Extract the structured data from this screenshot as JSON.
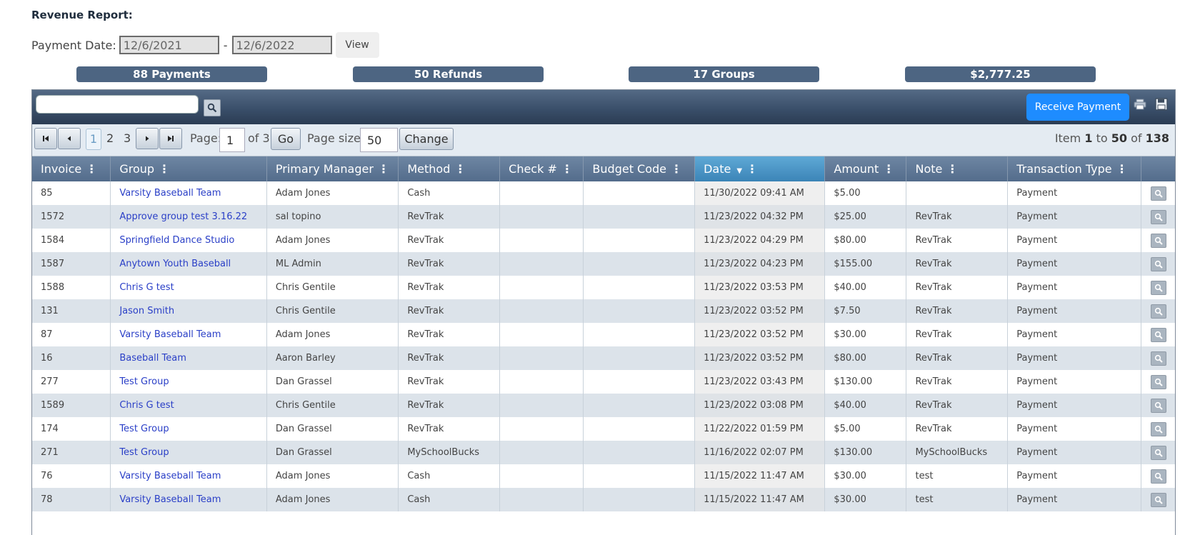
{
  "report": {
    "title": "Revenue Report:",
    "date_label": "Payment Date:",
    "date_from": "12/6/2021",
    "date_sep": "-",
    "date_to": "12/6/2022",
    "view_label": "View"
  },
  "summary": {
    "payments": "88 Payments",
    "refunds": "50 Refunds",
    "groups": "17 Groups",
    "total": "$2,777.25"
  },
  "toolbar": {
    "search_value": "",
    "receive_label": "Receive Payment"
  },
  "pager": {
    "pages": [
      "1",
      "2",
      "3"
    ],
    "current_page": "1",
    "page_label": "Page:",
    "page_value": "1",
    "of_label": "of 3",
    "go_label": "Go",
    "size_label": "Page size:",
    "size_value": "50",
    "change_label": "Change",
    "info_prefix": "Item",
    "info_from": "1",
    "info_to_label": "to",
    "info_to": "50",
    "info_of_label": "of",
    "info_total": "138"
  },
  "columns": [
    "Invoice",
    "Group",
    "Primary Manager",
    "Method",
    "Check #",
    "Budget Code",
    "Date",
    "Amount",
    "Note",
    "Transaction Type"
  ],
  "sorted_column": "Date",
  "rows": [
    {
      "invoice": "85",
      "group": "Varsity Baseball Team",
      "manager": "Adam Jones",
      "method": "Cash",
      "check": "",
      "budget": "",
      "date": "11/30/2022 09:41 AM",
      "amount": "$5.00",
      "note": "",
      "type": "Payment"
    },
    {
      "invoice": "1572",
      "group": "Approve group test 3.16.22",
      "manager": "sal topino",
      "method": "RevTrak",
      "check": "",
      "budget": "",
      "date": "11/23/2022 04:32 PM",
      "amount": "$25.00",
      "note": "RevTrak",
      "type": "Payment"
    },
    {
      "invoice": "1584",
      "group": "Springfield Dance Studio",
      "manager": "Adam Jones",
      "method": "RevTrak",
      "check": "",
      "budget": "",
      "date": "11/23/2022 04:29 PM",
      "amount": "$80.00",
      "note": "RevTrak",
      "type": "Payment"
    },
    {
      "invoice": "1587",
      "group": "Anytown Youth Baseball",
      "manager": "ML Admin",
      "method": "RevTrak",
      "check": "",
      "budget": "",
      "date": "11/23/2022 04:23 PM",
      "amount": "$155.00",
      "note": "RevTrak",
      "type": "Payment"
    },
    {
      "invoice": "1588",
      "group": "Chris G test",
      "manager": "Chris Gentile",
      "method": "RevTrak",
      "check": "",
      "budget": "",
      "date": "11/23/2022 03:53 PM",
      "amount": "$40.00",
      "note": "RevTrak",
      "type": "Payment"
    },
    {
      "invoice": "131",
      "group": "Jason Smith",
      "manager": "Chris Gentile",
      "method": "RevTrak",
      "check": "",
      "budget": "",
      "date": "11/23/2022 03:52 PM",
      "amount": "$7.50",
      "note": "RevTrak",
      "type": "Payment"
    },
    {
      "invoice": "87",
      "group": "Varsity Baseball Team",
      "manager": "Adam Jones",
      "method": "RevTrak",
      "check": "",
      "budget": "",
      "date": "11/23/2022 03:52 PM",
      "amount": "$30.00",
      "note": "RevTrak",
      "type": "Payment"
    },
    {
      "invoice": "16",
      "group": "Baseball Team",
      "manager": "Aaron Barley",
      "method": "RevTrak",
      "check": "",
      "budget": "",
      "date": "11/23/2022 03:52 PM",
      "amount": "$80.00",
      "note": "RevTrak",
      "type": "Payment"
    },
    {
      "invoice": "277",
      "group": "Test Group",
      "manager": "Dan Grassel",
      "method": "RevTrak",
      "check": "",
      "budget": "",
      "date": "11/23/2022 03:43 PM",
      "amount": "$130.00",
      "note": "RevTrak",
      "type": "Payment"
    },
    {
      "invoice": "1589",
      "group": "Chris G test",
      "manager": "Chris Gentile",
      "method": "RevTrak",
      "check": "",
      "budget": "",
      "date": "11/23/2022 03:08 PM",
      "amount": "$40.00",
      "note": "RevTrak",
      "type": "Payment"
    },
    {
      "invoice": "174",
      "group": "Test Group",
      "manager": "Dan Grassel",
      "method": "RevTrak",
      "check": "",
      "budget": "",
      "date": "11/22/2022 01:59 PM",
      "amount": "$5.00",
      "note": "RevTrak",
      "type": "Payment"
    },
    {
      "invoice": "271",
      "group": "Test Group",
      "manager": "Dan Grassel",
      "method": "MySchoolBucks",
      "check": "",
      "budget": "",
      "date": "11/16/2022 02:07 PM",
      "amount": "$130.00",
      "note": "MySchoolBucks",
      "type": "Payment"
    },
    {
      "invoice": "76",
      "group": "Varsity Baseball Team",
      "manager": "Adam Jones",
      "method": "Cash",
      "check": "",
      "budget": "",
      "date": "11/15/2022 11:47 AM",
      "amount": "$30.00",
      "note": "test",
      "type": "Payment"
    },
    {
      "invoice": "78",
      "group": "Varsity Baseball Team",
      "manager": "Adam Jones",
      "method": "Cash",
      "check": "",
      "budget": "",
      "date": "11/15/2022 11:47 AM",
      "amount": "$30.00",
      "note": "test",
      "type": "Payment"
    }
  ],
  "colors": {
    "summary_bg": "#4d6582",
    "link": "#2a3fc7",
    "accent": "#1e8cff"
  }
}
